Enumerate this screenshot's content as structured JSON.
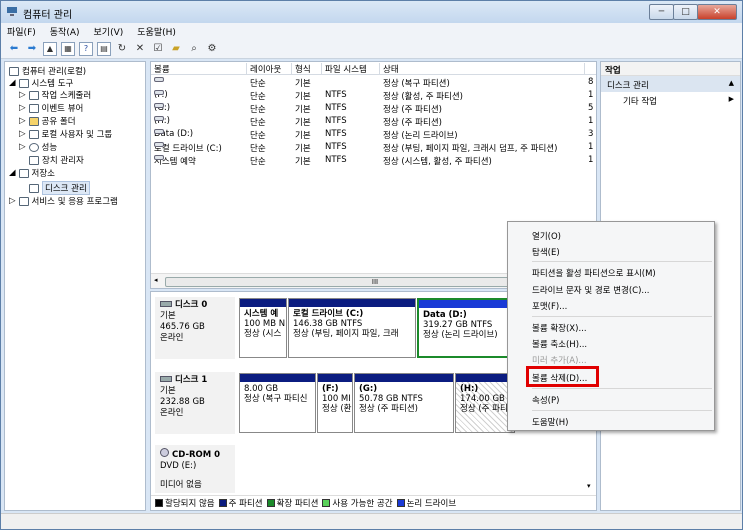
{
  "window": {
    "title": "컴퓨터 관리",
    "min": "─",
    "max": "□",
    "close": "✕"
  },
  "menu": [
    "파일(F)",
    "동작(A)",
    "보기(V)",
    "도움말(H)"
  ],
  "tree": [
    {
      "label": "컴퓨터 관리(로컬)",
      "icon": "computer-icon"
    },
    {
      "label": "시스템 도구",
      "icon": "tools-icon"
    },
    {
      "label": "작업 스케줄러",
      "icon": "clock-icon"
    },
    {
      "label": "이벤트 뷰어",
      "icon": "event-icon"
    },
    {
      "label": "공유 폴더",
      "icon": "folder-icon"
    },
    {
      "label": "로컬 사용자 및 그룹",
      "icon": "users-icon"
    },
    {
      "label": "성능",
      "icon": "performance-icon"
    },
    {
      "label": "장치 관리자",
      "icon": "device-icon"
    },
    {
      "label": "저장소",
      "icon": "storage-icon"
    },
    {
      "label": "디스크 관리",
      "icon": "disk-icon"
    },
    {
      "label": "서비스 및 응용 프로그램",
      "icon": "services-icon"
    }
  ],
  "list": {
    "headers": [
      "볼륨",
      "레이아웃",
      "형식",
      "파일 시스템",
      "상태",
      ""
    ],
    "rows": [
      [
        "",
        "단순",
        "기본",
        "",
        "정상 (복구 파티션)",
        "8"
      ],
      [
        "(F:)",
        "단순",
        "기본",
        "NTFS",
        "정상 (활성, 주 파티션)",
        "1"
      ],
      [
        "(G:)",
        "단순",
        "기본",
        "NTFS",
        "정상 (주 파티션)",
        "5"
      ],
      [
        "(H:)",
        "단순",
        "기본",
        "NTFS",
        "정상 (주 파티션)",
        "1"
      ],
      [
        "Data (D:)",
        "단순",
        "기본",
        "NTFS",
        "정상 (논리 드라이브)",
        "3"
      ],
      [
        "로컬 드라이브 (C:)",
        "단순",
        "기본",
        "NTFS",
        "정상 (부팅, 페이지 파일, 크래시 덤프, 주 파티션)",
        "1"
      ],
      [
        "시스템 예약",
        "단순",
        "기본",
        "NTFS",
        "정상 (시스템, 활성, 주 파티션)",
        "1"
      ]
    ],
    "scroll_mark": "III"
  },
  "disks": [
    {
      "name": "디스크 0",
      "type": "기본",
      "size": "465.76 GB",
      "status": "온라인",
      "parts": [
        {
          "title": "시스템 예",
          "size": "100 MB N",
          "status": "정상 (시스"
        },
        {
          "title": "로컬 드라이브  (C:)",
          "size": "146.38 GB NTFS",
          "status": "정상 (부팅, 페이지 파일, 크래"
        },
        {
          "title": "Data  (D:)",
          "size": "319.27 GB NTFS",
          "status": "정상 (논리 드라이브)"
        }
      ]
    },
    {
      "name": "디스크 1",
      "type": "기본",
      "size": "232.88 GB",
      "status": "온라인",
      "parts": [
        {
          "title": "",
          "size": "8.00 GB",
          "status": "정상 (복구 파티신"
        },
        {
          "title": "(F:)",
          "size": "100 MI",
          "status": "정상 (환"
        },
        {
          "title": "(G:)",
          "size": "50.78 GB NTFS",
          "status": "정상 (주 파티션)"
        },
        {
          "title": "(H:)",
          "size": "174.00 GB NTFS",
          "status": "정상 (주 파티"
        }
      ]
    },
    {
      "name": "CD-ROM 0",
      "type": "DVD (E:)",
      "size": "",
      "status": "미디어 없음"
    }
  ],
  "legend": [
    "할당되지 않음",
    "주 파티션",
    "확장 파티션",
    "사용 가능한 공간",
    "논리 드라이브"
  ],
  "legend_colors": [
    "#000000",
    "#0b1c80",
    "#1b8a2a",
    "#5ad25a",
    "#1a3ad6"
  ],
  "actions": {
    "header": "작업",
    "section": "디스크 관리",
    "item": "기타 작업"
  },
  "context_menu": [
    {
      "label": "열기(O)",
      "enabled": true
    },
    {
      "label": "탐색(E)",
      "enabled": true
    },
    {
      "label": "파티션을 활성 파티션으로 표시(M)",
      "enabled": true
    },
    {
      "label": "드라이브 문자 및 경로 변경(C)...",
      "enabled": true
    },
    {
      "label": "포맷(F)...",
      "enabled": true
    },
    {
      "label": "볼륨 확장(X)...",
      "enabled": true
    },
    {
      "label": "볼륨 축소(H)...",
      "enabled": true
    },
    {
      "label": "미러 추가(A)...",
      "enabled": false
    },
    {
      "label": "볼륨 삭제(D)...",
      "enabled": true
    },
    {
      "label": "속성(P)",
      "enabled": true
    },
    {
      "label": "도움말(H)",
      "enabled": true
    }
  ]
}
